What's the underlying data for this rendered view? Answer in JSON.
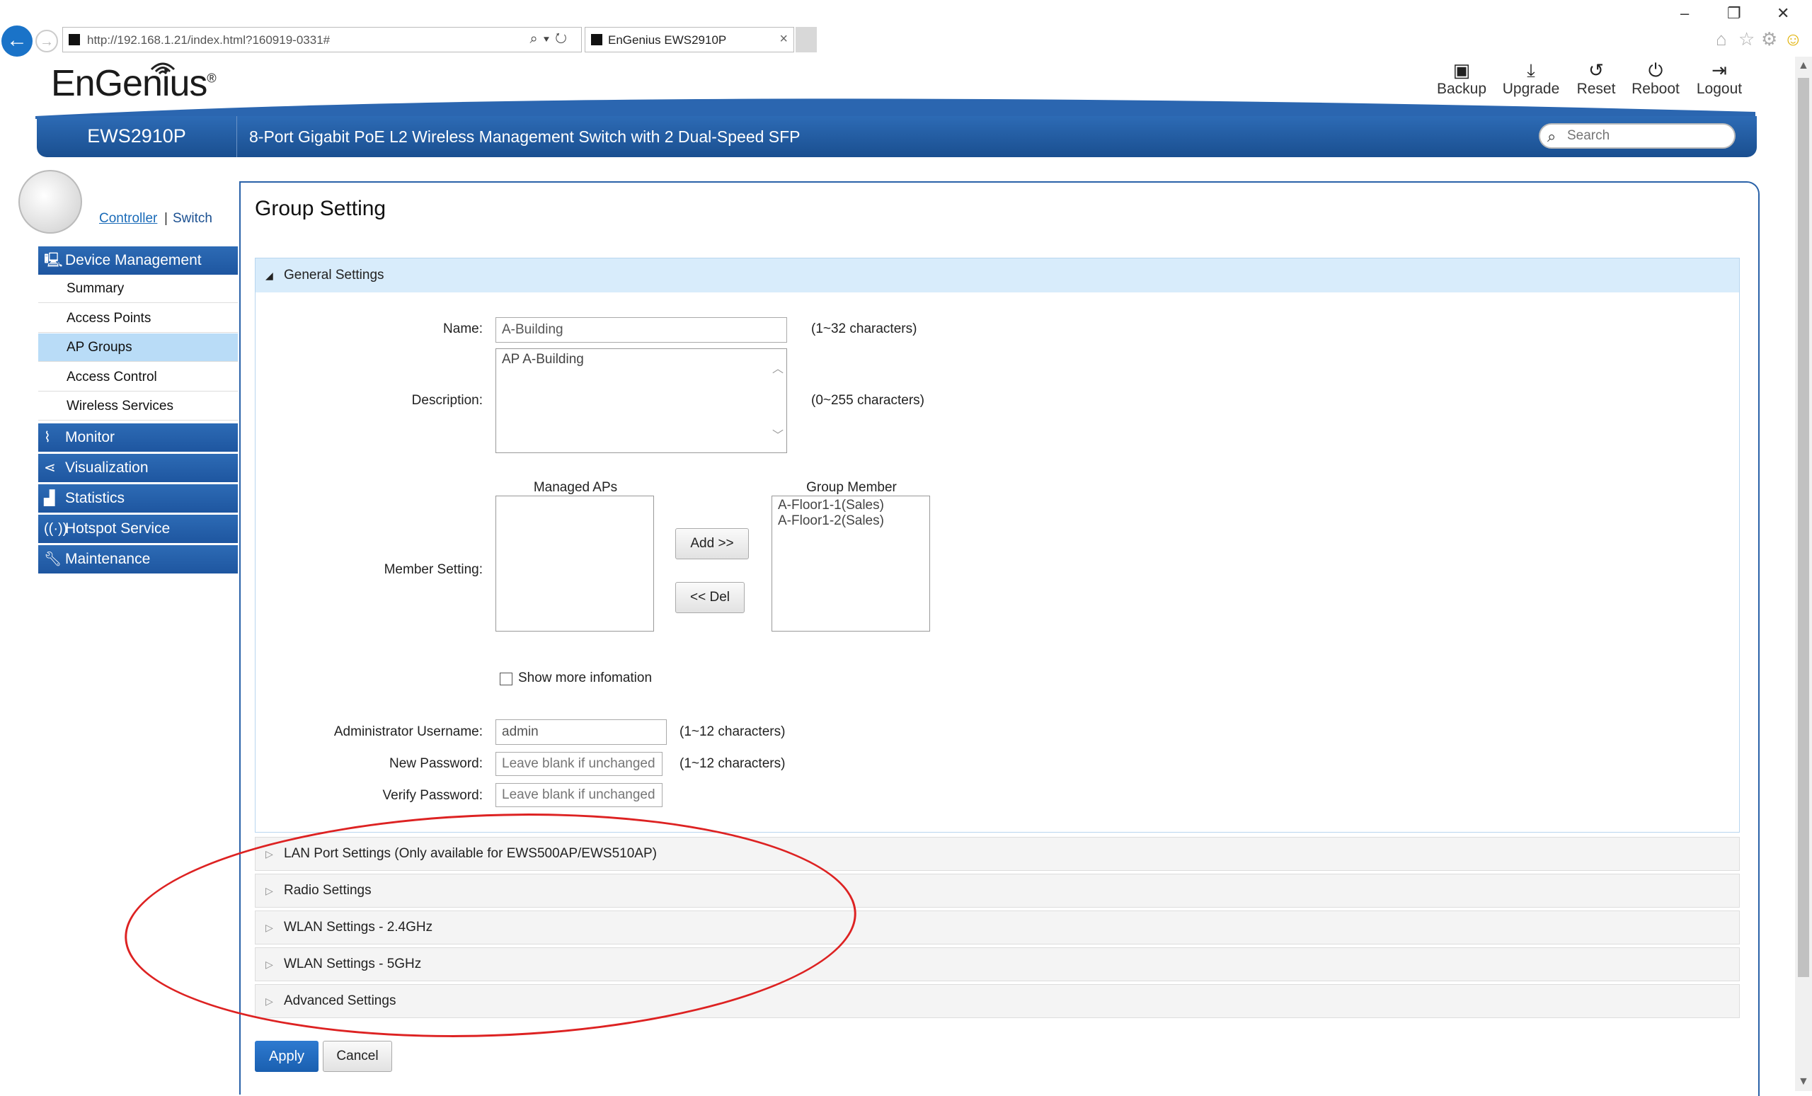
{
  "browser": {
    "url": "http://192.168.1.21/index.html?160919-0331#",
    "tab_title": "EnGenius EWS2910P",
    "tab_close": "×",
    "win_min": "–",
    "win_restore": "❐",
    "win_close": "✕"
  },
  "header": {
    "logo": "EnGenius",
    "logo_reg": "®",
    "model": "EWS2910P",
    "description": "8-Port Gigabit PoE L2 Wireless Management Switch with 2 Dual-Speed SFP",
    "search_placeholder": "Search",
    "actions": {
      "backup": "Backup",
      "upgrade": "Upgrade",
      "reset": "Reset",
      "reboot": "Reboot",
      "logout": "Logout"
    }
  },
  "sidebar": {
    "mode_controller": "Controller",
    "mode_sep": "|",
    "mode_switch": "Switch",
    "device_management": "Device Management",
    "items": [
      "Summary",
      "Access Points",
      "AP Groups",
      "Access Control",
      "Wireless Services"
    ],
    "active_item": "AP Groups",
    "sections": [
      "Monitor",
      "Visualization",
      "Statistics",
      "Hotspot Service",
      "Maintenance"
    ]
  },
  "main": {
    "title": "Group Setting",
    "general": {
      "header": "General Settings",
      "name_label": "Name:",
      "name_value": "A-Building",
      "name_note": "(1~32 characters)",
      "desc_label": "Description:",
      "desc_value": "AP A-Building",
      "desc_note": "(0~255 characters)",
      "member_label": "Member Setting:",
      "managed_aps_header": "Managed APs",
      "group_member_header": "Group Member",
      "group_members": [
        "A-Floor1-1(Sales)",
        "A-Floor1-2(Sales)"
      ],
      "add_button": "Add >>",
      "del_button": "<< Del",
      "show_more": "Show more infomation",
      "admin_user_label": "Administrator Username:",
      "admin_user_value": "admin",
      "admin_user_note": "(1~12 characters)",
      "new_pw_label": "New Password:",
      "new_pw_placeholder": "Leave blank if unchanged",
      "new_pw_note": "(1~12 characters)",
      "verify_pw_label": "Verify Password:",
      "verify_pw_placeholder": "Leave blank if unchanged"
    },
    "sections": [
      "LAN Port Settings (Only available for EWS500AP/EWS510AP)",
      "Radio Settings",
      "WLAN Settings - 2.4GHz",
      "WLAN Settings - 5GHz",
      "Advanced Settings"
    ],
    "apply": "Apply",
    "cancel": "Cancel"
  },
  "colors": {
    "brand_blue": "#1e56a0",
    "active_item": "#b9dcf7",
    "annotation_circle": "#dd2222"
  }
}
